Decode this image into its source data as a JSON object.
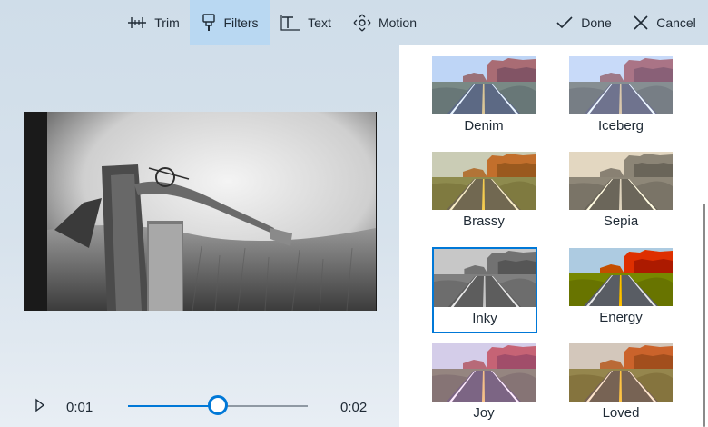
{
  "toolbar": {
    "trim_label": "Trim",
    "filters_label": "Filters",
    "text_label": "Text",
    "motion_label": "Motion",
    "done_label": "Done",
    "cancel_label": "Cancel",
    "active_tab": "Filters"
  },
  "playback": {
    "current_time": "0:01",
    "end_time": "0:02",
    "progress": 0.5
  },
  "filters": [
    {
      "label": "Denim",
      "selected": false
    },
    {
      "label": "Iceberg",
      "selected": false
    },
    {
      "label": "Brassy",
      "selected": false
    },
    {
      "label": "Sepia",
      "selected": false
    },
    {
      "label": "Inky",
      "selected": true
    },
    {
      "label": "Energy",
      "selected": false
    },
    {
      "label": "Joy",
      "selected": false
    },
    {
      "label": "Loved",
      "selected": false
    }
  ],
  "colors": {
    "accent": "#0078d7",
    "active_tab_bg": "#b9d8f2"
  }
}
